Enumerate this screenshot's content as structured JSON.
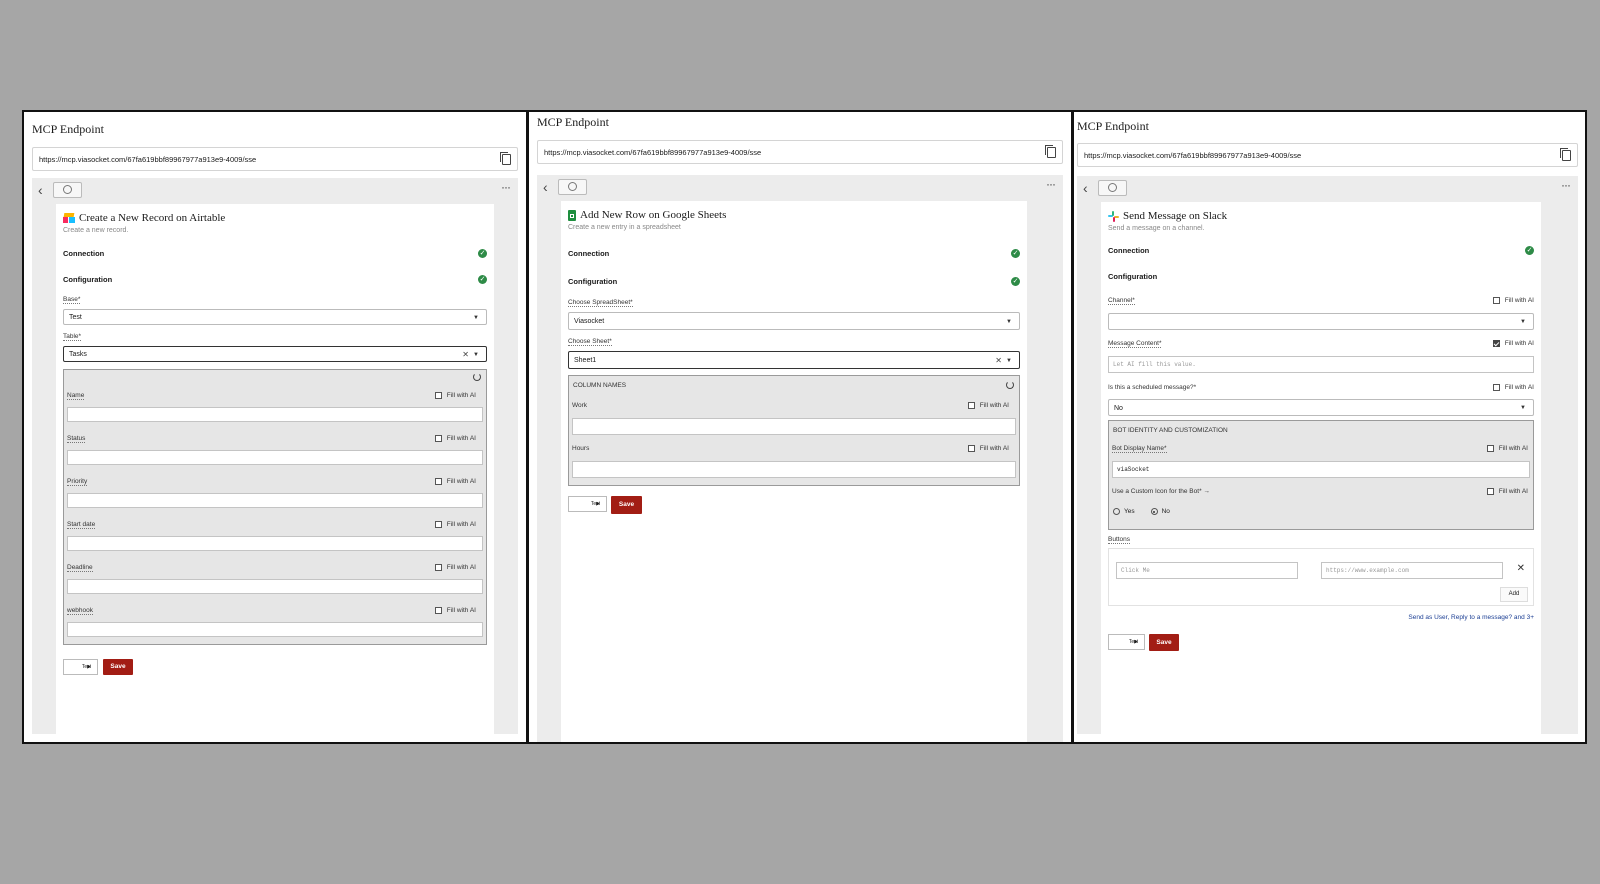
{
  "panels": [
    {
      "mcp_title": "MCP Endpoint",
      "url": "https://mcp.viasocket.com/67fa619bbf89967977a913e9-4009/sse",
      "card_title": "Create a New Record on Airtable",
      "card_subtitle": "Create a new record.",
      "connection_label": "Connection",
      "configuration_label": "Configuration",
      "base_label": "Base*",
      "base_value": "Test",
      "table_label": "Table*",
      "table_value": "Tasks",
      "columns": [
        "Name",
        "Status",
        "Priority",
        "Start date",
        "Deadline",
        "webhook"
      ],
      "fill_ai": "Fill with AI",
      "test_label": "Test",
      "save_label": "Save"
    },
    {
      "mcp_title": "MCP Endpoint",
      "url": "https://mcp.viasocket.com/67fa619bbf89967977a913e9-4009/sse",
      "card_title": "Add New Row on Google Sheets",
      "card_subtitle": "Create a new entry in a spreadsheet",
      "connection_label": "Connection",
      "configuration_label": "Configuration",
      "spreadsheet_label": "Choose SpreadSheet*",
      "spreadsheet_value": "Viasocket",
      "sheet_label": "Choose Sheet*",
      "sheet_value": "Sheet1",
      "columns_heading": "COLUMN NAMES",
      "columns": [
        "Work",
        "Hours"
      ],
      "fill_ai": "Fill with AI",
      "test_label": "Test",
      "save_label": "Save"
    },
    {
      "mcp_title": "MCP Endpoint",
      "url": "https://mcp.viasocket.com/67fa619bbf89967977a913e9-4009/sse",
      "card_title": "Send Message on Slack",
      "card_subtitle": "Send a message on a channel.",
      "connection_label": "Connection",
      "configuration_label": "Configuration",
      "channel_label": "Channel*",
      "message_label": "Message Content*",
      "message_placeholder": "Let AI fill this value.",
      "scheduled_label": "Is this a scheduled message?*",
      "scheduled_value": "No",
      "bot_heading": "BOT IDENTITY AND CUSTOMIZATION",
      "bot_name_label": "Bot Display Name*",
      "bot_name_value": "viaSocket",
      "custom_icon_label": "Use a Custom Icon for the Bot* →",
      "radio_yes": "Yes",
      "radio_no": "No",
      "buttons_label": "Buttons",
      "button_text_placeholder": "Click Me",
      "button_url_placeholder": "https://www.example.com",
      "add_label": "Add",
      "more_link": "Send as User, Reply to a message? and 3+",
      "fill_ai": "Fill with AI",
      "test_label": "Test",
      "save_label": "Save"
    }
  ],
  "colors": {
    "save": "#a21d14",
    "success": "#2e8b47",
    "link": "#1c3f94",
    "background": "#a6a6a6"
  }
}
